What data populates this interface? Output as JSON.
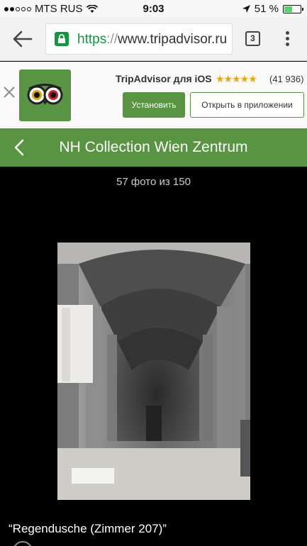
{
  "status_bar": {
    "carrier": "MTS RUS",
    "time": "9:03",
    "battery": "51 %",
    "battery_level": 0.51,
    "signal_dots_filled": 2,
    "signal_dots_total": 5
  },
  "browser": {
    "url_scheme": "https",
    "url_separator": "://",
    "url_host": "www.tripadvisor.ru",
    "tab_count": "3",
    "icons": [
      "back-arrow-icon",
      "lock-icon",
      "tabs-icon",
      "menu-icon"
    ]
  },
  "app_banner": {
    "title": "TripAdvisor для iOS",
    "rating": 4.5,
    "stars": "★★★★★",
    "review_count": "(41 936)",
    "install_label": "Установить",
    "open_label": "Открыть в приложении"
  },
  "header": {
    "title": "NH Collection Wien Zentrum"
  },
  "gallery": {
    "counter": "57 фото из 150",
    "caption": "“Regendusche (Zimmer 207)”"
  },
  "colors": {
    "brand_green": "#589442",
    "secure_green": "#0a9b3c",
    "star": "#f0a500"
  }
}
